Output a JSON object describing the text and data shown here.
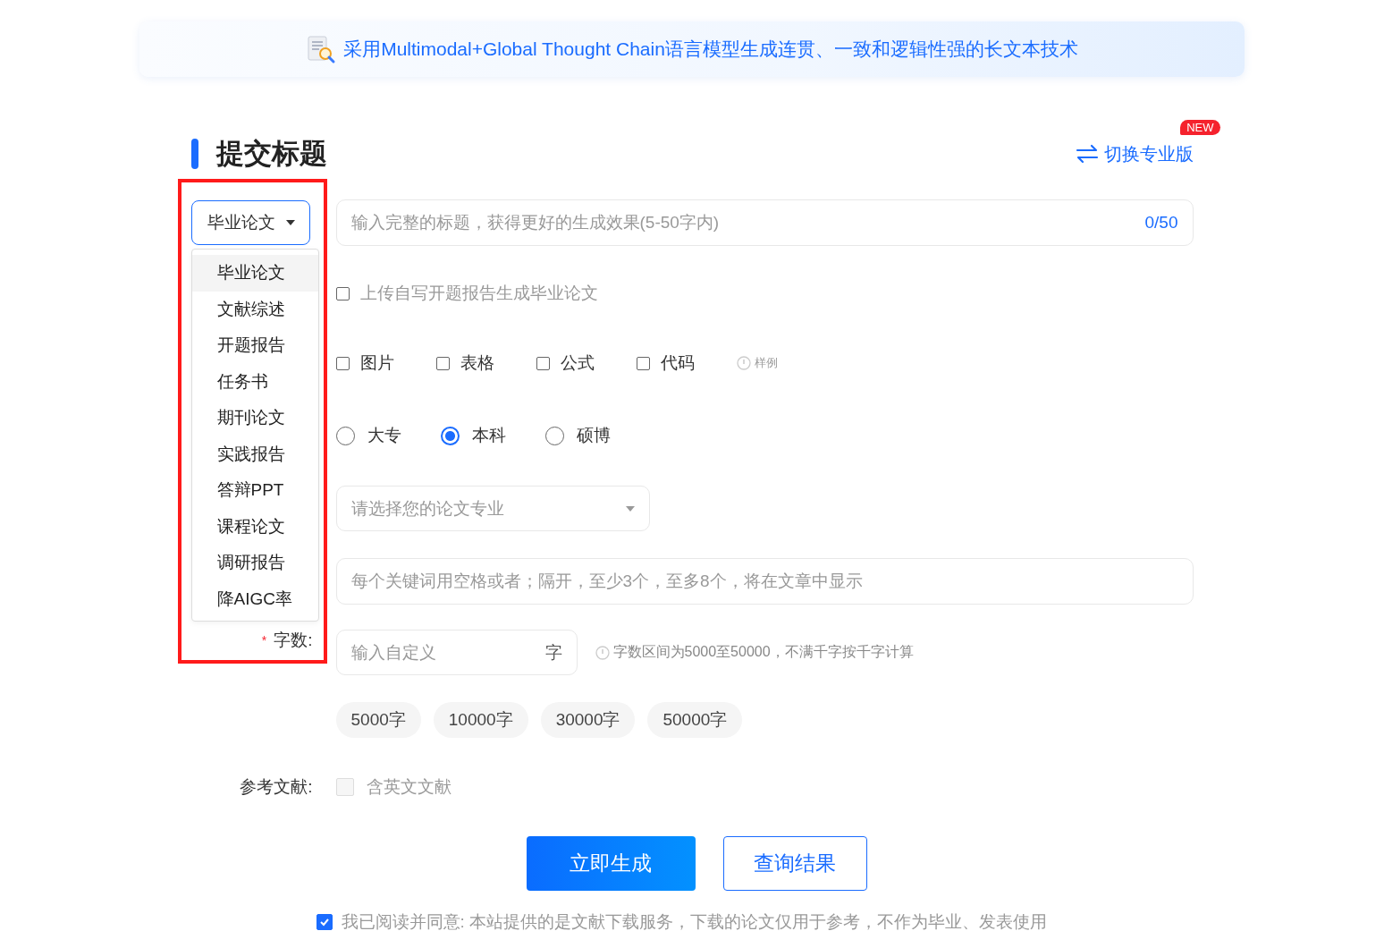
{
  "banner": {
    "text": "采用Multimodal+Global Thought Chain语言模型生成连贯、一致和逻辑性强的长文本技术"
  },
  "section": {
    "title": "提交标题",
    "switch_link": "切换专业版",
    "badge": "NEW"
  },
  "type_select": {
    "value": "毕业论文",
    "expanded": true,
    "options": [
      {
        "label": "毕业论文",
        "selected": true
      },
      {
        "label": "文献综述",
        "selected": false
      },
      {
        "label": "开题报告",
        "selected": false
      },
      {
        "label": "任务书",
        "selected": false
      },
      {
        "label": "期刊论文",
        "selected": false
      },
      {
        "label": "实践报告",
        "selected": false
      },
      {
        "label": "答辩PPT",
        "selected": false
      },
      {
        "label": "课程论文",
        "selected": false
      },
      {
        "label": "调研报告",
        "selected": false
      },
      {
        "label": "降AIGC率",
        "selected": false
      }
    ]
  },
  "title_field": {
    "placeholder": "输入完整的标题，获得更好的生成效果(5-50字内)",
    "counter": "0/50"
  },
  "upload_option": {
    "label": "上传自写开题报告生成毕业论文",
    "checked": false
  },
  "features": [
    {
      "label": "图片",
      "checked": false
    },
    {
      "label": "表格",
      "checked": false
    },
    {
      "label": "公式",
      "checked": false
    },
    {
      "label": "代码",
      "checked": false
    }
  ],
  "example_link": "样例",
  "degrees": [
    {
      "label": "大专",
      "selected": false
    },
    {
      "label": "本科",
      "selected": true
    },
    {
      "label": "硕博",
      "selected": false
    }
  ],
  "major_select": {
    "placeholder": "请选择您的论文专业"
  },
  "keywords_field": {
    "placeholder": "每个关键词用空格或者；隔开，至少3个，至多8个，将在文章中显示"
  },
  "word_count": {
    "label": "字数:",
    "required_mark": "*",
    "placeholder": "输入自定义",
    "unit": "字",
    "hint": "字数区间为5000至50000，不满千字按千字计算"
  },
  "presets": [
    "5000字",
    "10000字",
    "30000字",
    "50000字"
  ],
  "references": {
    "label": "参考文献:",
    "option": "含英文文献",
    "checked": false
  },
  "actions": {
    "primary": "立即生成",
    "secondary": "查询结果"
  },
  "agreement": {
    "text": "我已阅读并同意: 本站提供的是文献下载服务，下载的论文仅用于参考，不作为毕业、发表使用",
    "checked": true
  }
}
